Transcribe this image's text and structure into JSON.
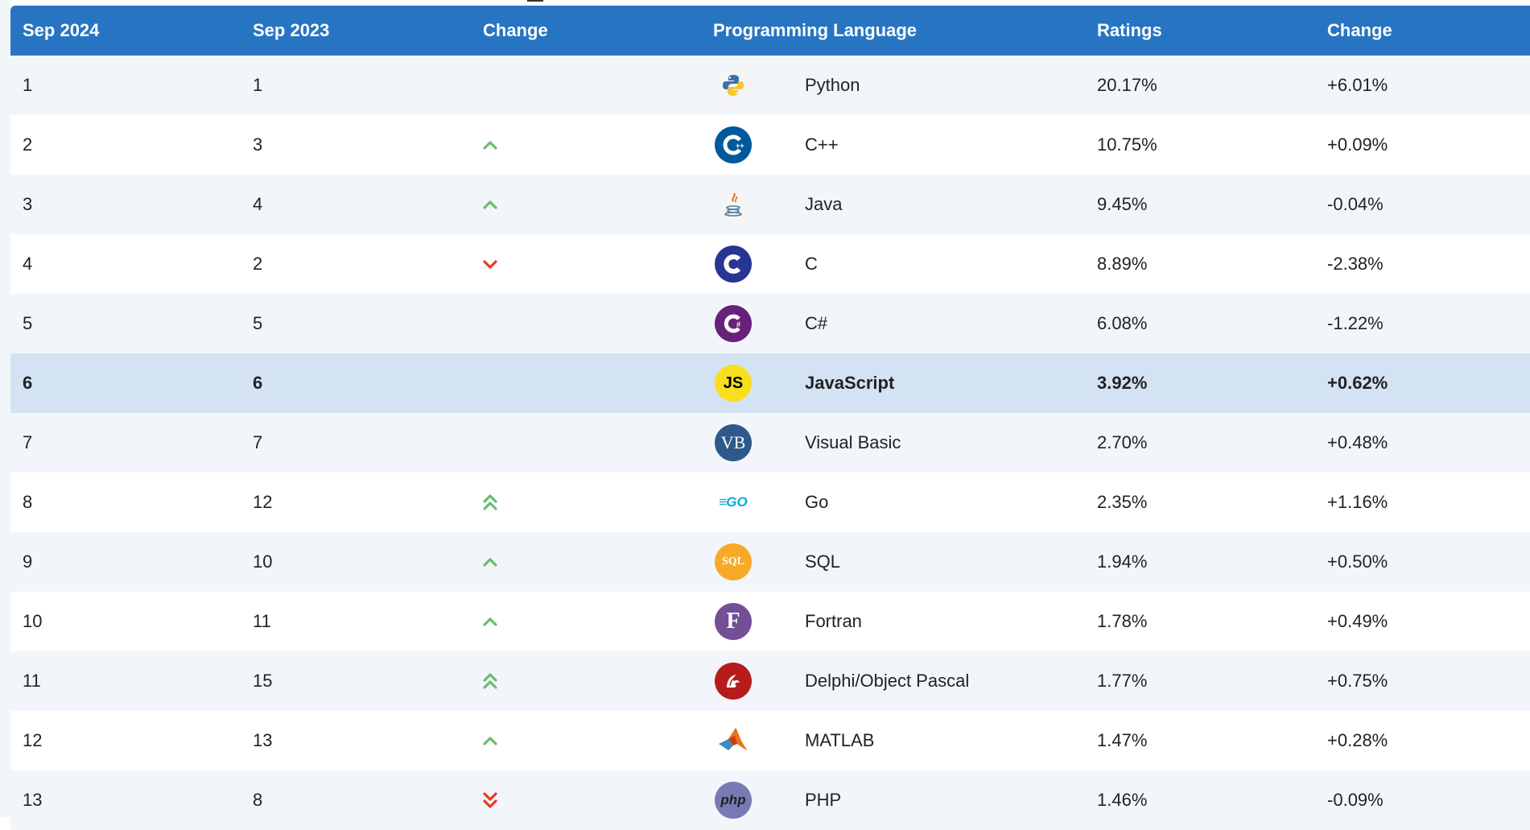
{
  "colors": {
    "header_bg": "#2775c2",
    "up": "#6bbd6e",
    "down": "#e53b1d",
    "row_alt": "#f2f6fa",
    "row_highlight": "#d4e3f4"
  },
  "table": {
    "headers": [
      "Sep 2024",
      "Sep 2023",
      "Change",
      "Programming Language",
      "Ratings",
      "Change"
    ],
    "rows": [
      {
        "cur": "1",
        "prev": "1",
        "trend": "none",
        "icon": "python-logo-icon",
        "lang": "Python",
        "rating": "20.17%",
        "change": "+6.01%"
      },
      {
        "cur": "2",
        "prev": "3",
        "trend": "up",
        "icon": "cpp-logo-icon",
        "lang": "C++",
        "rating": "10.75%",
        "change": "+0.09%"
      },
      {
        "cur": "3",
        "prev": "4",
        "trend": "up",
        "icon": "java-logo-icon",
        "lang": "Java",
        "rating": "9.45%",
        "change": "-0.04%"
      },
      {
        "cur": "4",
        "prev": "2",
        "trend": "down",
        "icon": "c-logo-icon",
        "lang": "C",
        "rating": "8.89%",
        "change": "-2.38%"
      },
      {
        "cur": "5",
        "prev": "5",
        "trend": "none",
        "icon": "csharp-logo-icon",
        "lang": "C#",
        "rating": "6.08%",
        "change": "-1.22%"
      },
      {
        "cur": "6",
        "prev": "6",
        "trend": "none",
        "icon": "javascript-logo-icon",
        "lang": "JavaScript",
        "rating": "3.92%",
        "change": "+0.62%",
        "highlight": true
      },
      {
        "cur": "7",
        "prev": "7",
        "trend": "none",
        "icon": "visual-basic-logo-icon",
        "lang": "Visual Basic",
        "rating": "2.70%",
        "change": "+0.48%"
      },
      {
        "cur": "8",
        "prev": "12",
        "trend": "double-up",
        "icon": "go-logo-icon",
        "lang": "Go",
        "rating": "2.35%",
        "change": "+1.16%"
      },
      {
        "cur": "9",
        "prev": "10",
        "trend": "up",
        "icon": "sql-logo-icon",
        "lang": "SQL",
        "rating": "1.94%",
        "change": "+0.50%"
      },
      {
        "cur": "10",
        "prev": "11",
        "trend": "up",
        "icon": "fortran-logo-icon",
        "lang": "Fortran",
        "rating": "1.78%",
        "change": "+0.49%"
      },
      {
        "cur": "11",
        "prev": "15",
        "trend": "double-up",
        "icon": "delphi-logo-icon",
        "lang": "Delphi/Object Pascal",
        "rating": "1.77%",
        "change": "+0.75%"
      },
      {
        "cur": "12",
        "prev": "13",
        "trend": "up",
        "icon": "matlab-logo-icon",
        "lang": "MATLAB",
        "rating": "1.47%",
        "change": "+0.28%"
      },
      {
        "cur": "13",
        "prev": "8",
        "trend": "double-down",
        "icon": "php-logo-icon",
        "lang": "PHP",
        "rating": "1.46%",
        "change": "-0.09%"
      }
    ]
  },
  "logo_text": {
    "javascript": "JS",
    "visual_basic": "VB",
    "sql": "SQL",
    "fortran": "F",
    "php": "php",
    "go": "GO"
  }
}
